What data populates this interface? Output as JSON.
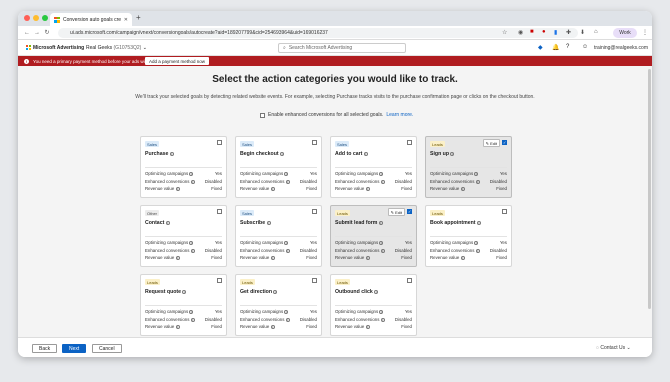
{
  "browser": {
    "tab_title": "Conversion auto goals creati...",
    "url": "ui.ads.microsoft.com/campaign/vnext/conversiongoals/autocreate?aid=189207799&cid=254693964&uid=169016237",
    "work_label": "Work"
  },
  "app": {
    "brand": "Microsoft Advertising",
    "account_name": "Real Geeks",
    "account_id": "(G10753Q2)",
    "search_placeholder": "Search Microsoft Advertising",
    "user_email": "training@realgeeks.com"
  },
  "alert": {
    "message": "You need a primary payment method before your ads will run.",
    "button": "Add a payment method now",
    "color": "#b01c20"
  },
  "page": {
    "title": "Select the action categories you would like to track.",
    "subtitle": "We'll track your selected goals by detecting related website events. For example, selecting Purchase tracks visits to the purchase confirmation page or clicks on the checkout button.",
    "enhanced_label": "Enable enhanced conversions for all selected goals.",
    "learn_more": "Learn more."
  },
  "row_labels": {
    "optimizing": "Optimizing campaigns",
    "enhanced": "Enhanced conversions",
    "revenue": "Revenue value"
  },
  "edit_label": "Edit",
  "cards": [
    {
      "badge": "Sales",
      "badge_type": "sales",
      "title": "Purchase",
      "optimizing": "Yes",
      "enhanced": "Disabled",
      "revenue": "Fixed",
      "selected": false
    },
    {
      "badge": "Sales",
      "badge_type": "sales",
      "title": "Begin checkout",
      "optimizing": "Yes",
      "enhanced": "Disabled",
      "revenue": "Fixed",
      "selected": false
    },
    {
      "badge": "Sales",
      "badge_type": "sales",
      "title": "Add to cart",
      "optimizing": "Yes",
      "enhanced": "Disabled",
      "revenue": "Fixed",
      "selected": false
    },
    {
      "badge": "Leads",
      "badge_type": "leads",
      "title": "Sign up",
      "optimizing": "Yes",
      "enhanced": "Disabled",
      "revenue": "Fixed",
      "selected": true
    },
    {
      "badge": "Other",
      "badge_type": "other",
      "title": "Contact",
      "optimizing": "Yes",
      "enhanced": "Disabled",
      "revenue": "Fixed",
      "selected": false
    },
    {
      "badge": "Sales",
      "badge_type": "sales",
      "title": "Subscribe",
      "optimizing": "Yes",
      "enhanced": "Disabled",
      "revenue": "Fixed",
      "selected": false
    },
    {
      "badge": "Leads",
      "badge_type": "leads",
      "title": "Submit lead form",
      "optimizing": "Yes",
      "enhanced": "Disabled",
      "revenue": "Fixed",
      "selected": true
    },
    {
      "badge": "Leads",
      "badge_type": "leads",
      "title": "Book appointment",
      "optimizing": "Yes",
      "enhanced": "Disabled",
      "revenue": "Fixed",
      "selected": false
    },
    {
      "badge": "Leads",
      "badge_type": "leads",
      "title": "Request quote",
      "optimizing": "Yes",
      "enhanced": "Disabled",
      "revenue": "Fixed",
      "selected": false
    },
    {
      "badge": "Leads",
      "badge_type": "leads",
      "title": "Get direction",
      "optimizing": "Yes",
      "enhanced": "Disabled",
      "revenue": "Fixed",
      "selected": false
    },
    {
      "badge": "Leads",
      "badge_type": "leads",
      "title": "Outbound click",
      "optimizing": "Yes",
      "enhanced": "Disabled",
      "revenue": "Fixed",
      "selected": false
    }
  ],
  "footer": {
    "back": "Back",
    "next": "Next",
    "cancel": "Cancel",
    "contact": "Contact Us"
  },
  "colors": {
    "accent": "#0b62c4",
    "selected_card": "#e6e6e6"
  }
}
